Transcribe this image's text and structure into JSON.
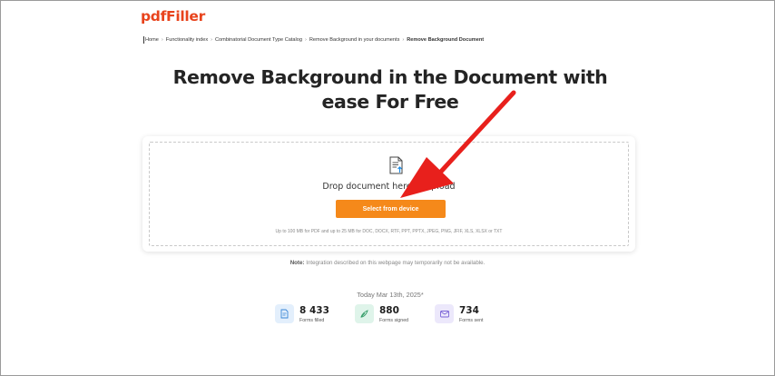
{
  "logo": "pdfFiller",
  "breadcrumb": {
    "items": [
      "Home",
      "Functionality index",
      "Combinatorial Document Type Catalog",
      "Remove Background in your documents"
    ],
    "current": "Remove Background Document",
    "separator": "›"
  },
  "hero": {
    "line1": "Remove Background in the Document with",
    "line2": "ease For Free"
  },
  "upload": {
    "icon": "document-upload-icon",
    "drop_text": "Drop document here to upload",
    "button_label": "Select from device",
    "limits": "Up to 100 MB for PDF and up to 25 MB for DOC, DOCX, RTF, PPT, PPTX, JPEG, PNG, JFIF, XLS, XLSX or TXT"
  },
  "note": {
    "label": "Note:",
    "text": " Integration described on this webpage may temporarily not be available."
  },
  "today": "Today Mar 13th, 2025*",
  "stats": [
    {
      "value": "8 433",
      "label": "Forms filled",
      "icon": "form-icon"
    },
    {
      "value": "880",
      "label": "Forms signed",
      "icon": "signature-icon"
    },
    {
      "value": "734",
      "label": "Forms sent",
      "icon": "send-icon"
    }
  ],
  "colors": {
    "brand": "#e8431c",
    "button": "#f5891a",
    "annotation_arrow": "#e8201c",
    "stat_filled_bg": "#e3effc",
    "stat_signed_bg": "#dff4ea",
    "stat_sent_bg": "#ece8fb"
  }
}
